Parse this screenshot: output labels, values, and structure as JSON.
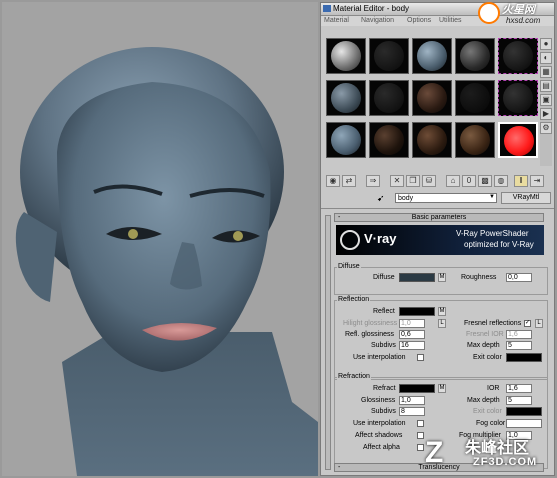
{
  "window": {
    "title": "Material Editor - body"
  },
  "menu": [
    "Material",
    "Navigation",
    "Options",
    "Utilities"
  ],
  "material": {
    "name": "body",
    "type": "VRayMtl"
  },
  "rollouts": {
    "basic": "Basic parameters",
    "translucency": "Translucency"
  },
  "banner": {
    "brand": "V·ray",
    "title": "V-Ray PowerShader",
    "subtitle": "optimized for V-Ray"
  },
  "diffuse": {
    "group": "Diffuse",
    "diffuse_label": "Diffuse",
    "diffuse_color": "#2b3a44",
    "map_btn": "M",
    "roughness_label": "Roughness",
    "roughness": "0,0"
  },
  "reflection": {
    "group": "Reflection",
    "reflect_label": "Reflect",
    "map_btn": "M",
    "hilight_label": "Hilight glossiness",
    "hilight": "1,0",
    "lock": "L",
    "refl_gloss_label": "Refl. glossiness",
    "refl_gloss": "0,6",
    "subdivs_label": "Subdivs",
    "subdivs": "16",
    "interp_label": "Use interpolation",
    "fresnel_label": "Fresnel reflections",
    "fresnel_ior_label": "Fresnel IOR",
    "fresnel_ior": "1,6",
    "maxdepth_label": "Max depth",
    "maxdepth": "5",
    "exit_label": "Exit color"
  },
  "refraction": {
    "group": "Refraction",
    "refract_label": "Refract",
    "map_btn": "M",
    "ior_label": "IOR",
    "ior": "1,6",
    "gloss_label": "Glossiness",
    "gloss": "1,0",
    "maxdepth_label": "Max depth",
    "maxdepth": "5",
    "subdivs_label": "Subdivs",
    "subdivs": "8",
    "exit_label": "Exit color",
    "interp_label": "Use interpolation",
    "fog_label": "Fog color",
    "shadows_label": "Affect shadows",
    "fogmult_label": "Fog multiplier",
    "fogmult": "1,0",
    "alpha_label": "Affect alpha"
  },
  "watermarks": {
    "top_cn": "火星网",
    "top_url": "hxsd.com",
    "bottom_cn": "朱峰社区",
    "bottom_url": "ZF3D.COM"
  },
  "colors": {
    "skin": "#5f7384",
    "sample_red": "#ff1a1a",
    "ui_bg": "#c8c8c8"
  }
}
